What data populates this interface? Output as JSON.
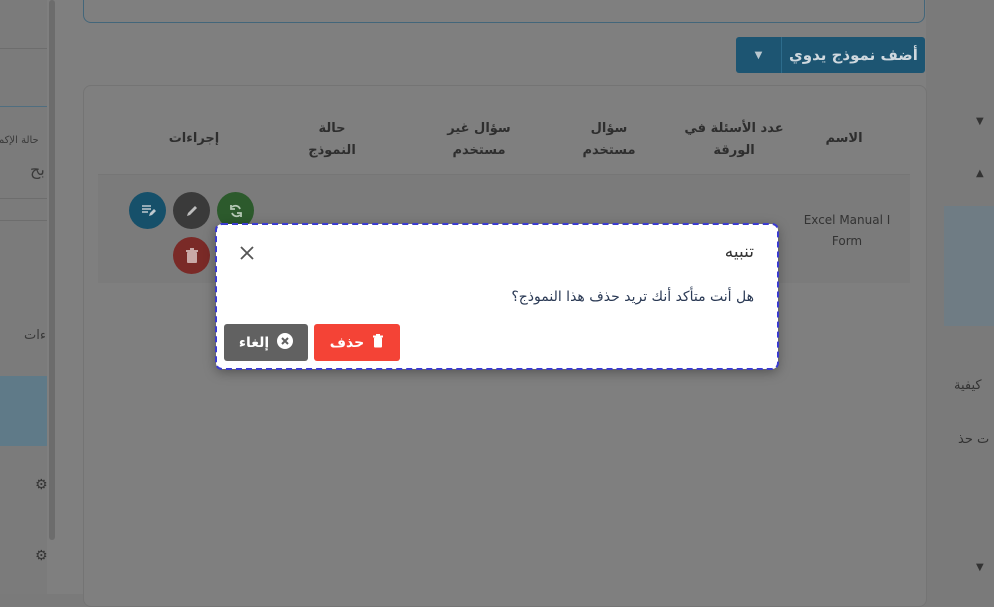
{
  "background": {
    "left_labels": [
      "حالة الإكم",
      "بح",
      "اءات"
    ],
    "right_labels": [
      "كيفية",
      "ت حذ"
    ]
  },
  "toolbar": {
    "add_button_label": "أضف نموذج يدوي"
  },
  "table": {
    "headers": {
      "name": "الاسم",
      "question_count": "عدد الأسئلة في الورقة",
      "used_question": "سؤال مستخدم",
      "unused_question": "سؤال غير مستخدم",
      "form_status": "حالة النموذج",
      "actions": "إجراءات"
    },
    "rows": [
      {
        "name": "Excel Manual I Form"
      }
    ]
  },
  "dialog": {
    "title": "تنبيه",
    "message": "هل أنت متأكد أنك تريد حذف هذا النموذج؟",
    "delete_label": "حذف",
    "cancel_label": "إلغاء"
  },
  "colors": {
    "delete": "#f44336",
    "cancel": "#616161",
    "primary": "#1d5572",
    "focus_outline": "#3b3bd0"
  }
}
